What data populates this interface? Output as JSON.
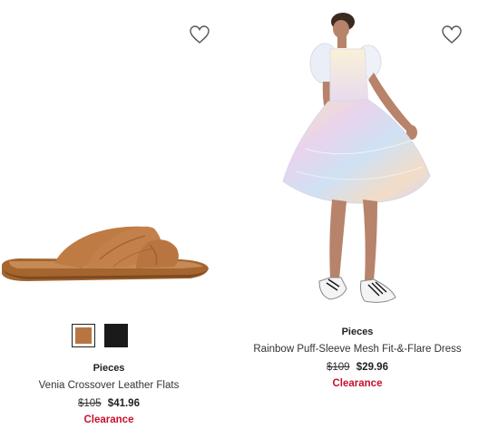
{
  "products": [
    {
      "brand": "Pieces",
      "name": "Venia Crossover Leather Flats",
      "original_price": "$105",
      "sale_price": "$41.96",
      "badge": "Clearance",
      "swatches": [
        {
          "color": "#b87542",
          "selected": true
        },
        {
          "color": "#1a1a1a",
          "selected": false
        }
      ],
      "wishlist_icon": "heart-outline-icon"
    },
    {
      "brand": "Pieces",
      "name": "Rainbow Puff-Sleeve Mesh Fit-&-Flare Dress",
      "original_price": "$109",
      "sale_price": "$29.96",
      "badge": "Clearance",
      "wishlist_icon": "heart-outline-icon"
    }
  ],
  "colors": {
    "clearance": "#c8102e",
    "text": "#222222"
  }
}
